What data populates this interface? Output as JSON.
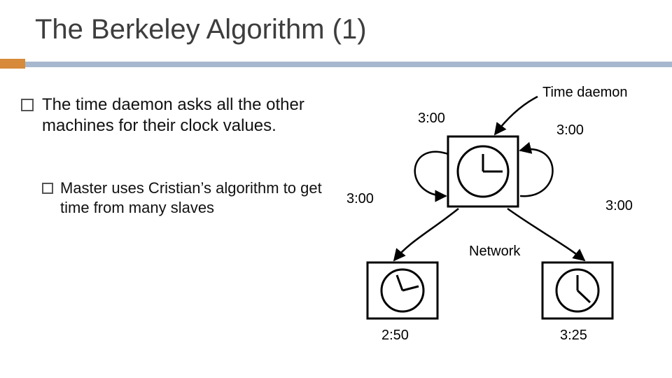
{
  "title": "The Berkeley Algorithm (1)",
  "bullets": {
    "main": "The time daemon asks all the other machines for their clock values.",
    "sub": "Master uses Cristian’s algorithm to get time from many slaves"
  },
  "diagram": {
    "label_time_daemon": "Time daemon",
    "label_network": "Network",
    "master": {
      "announce_left": "3:00",
      "announce_right": "3:00",
      "announce_self_left": "3:00",
      "announce_self_right": "3:00"
    },
    "slaves": {
      "left_clock": "2:50",
      "right_clock": "3:25"
    }
  }
}
